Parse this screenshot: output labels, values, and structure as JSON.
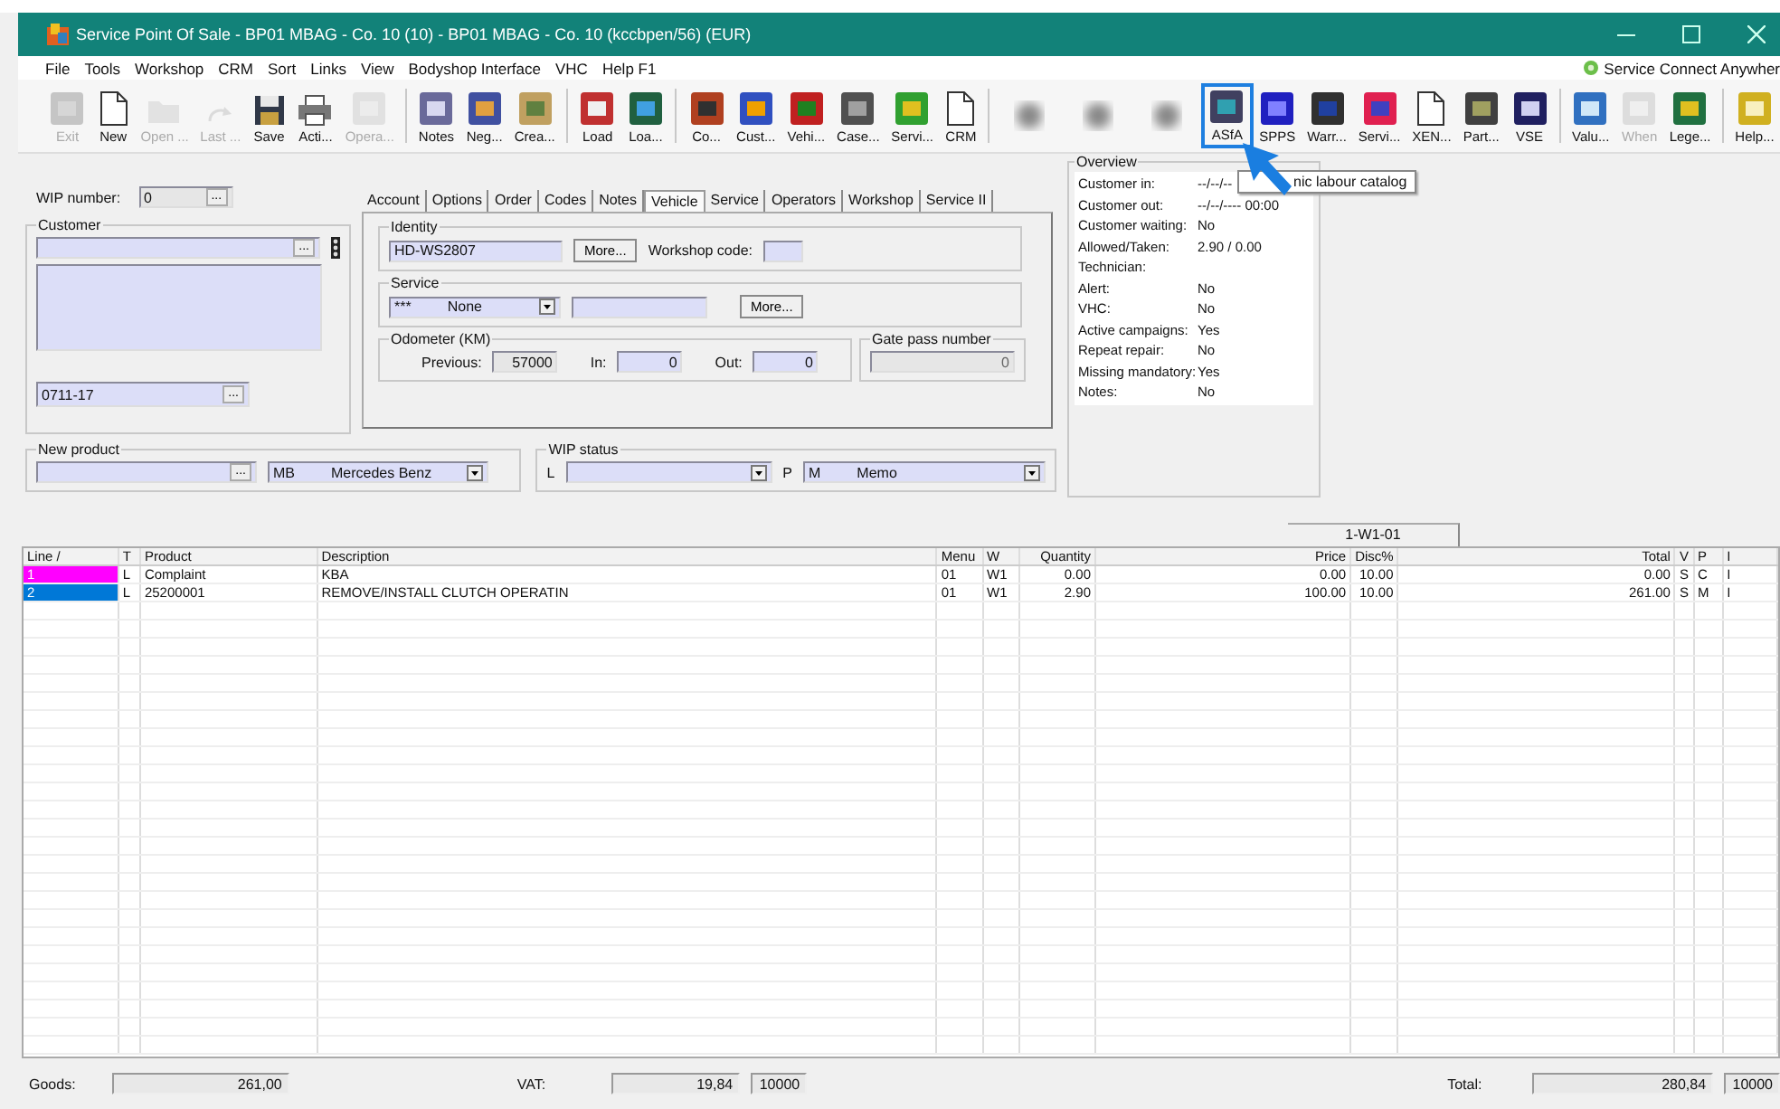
{
  "window": {
    "title": "Service Point Of Sale - BP01 MBAG - Co. 10 (10) - BP01 MBAG - Co. 10 (kccbpen/56) (EUR)"
  },
  "menu": [
    "File",
    "Tools",
    "Workshop",
    "CRM",
    "Sort",
    "Links",
    "View",
    "Bodyshop Interface",
    "VHC",
    "Help F1"
  ],
  "service_connect": "Service Connect Anywher",
  "toolbar": [
    [
      {
        "kind": "button",
        "label": "Exit",
        "disabled": true,
        "selected": false
      },
      {
        "kind": "button",
        "label": "New",
        "disabled": false,
        "selected": false
      },
      {
        "kind": "button",
        "label": "Open ... ",
        "disabled": true,
        "selected": false
      },
      {
        "kind": "button",
        "label": "Last ...",
        "disabled": true,
        "selected": false
      },
      {
        "kind": "button",
        "label": "Save",
        "disabled": false,
        "selected": false
      },
      {
        "kind": "button",
        "label": "Acti...",
        "disabled": false,
        "selected": false
      },
      {
        "kind": "button",
        "label": "Opera...",
        "disabled": true,
        "selected": false
      }
    ],
    [
      {
        "kind": "button",
        "label": "Notes",
        "disabled": false,
        "selected": false
      },
      {
        "kind": "button",
        "label": "Neg...",
        "disabled": false,
        "selected": false
      },
      {
        "kind": "button",
        "label": "Crea...",
        "disabled": false,
        "selected": false
      }
    ],
    [
      {
        "kind": "button",
        "label": "Load",
        "disabled": false,
        "selected": false
      },
      {
        "kind": "button",
        "label": "Loa...",
        "disabled": false,
        "selected": false
      }
    ],
    [
      {
        "kind": "button",
        "label": "Co...",
        "disabled": false,
        "selected": false
      },
      {
        "kind": "button",
        "label": "Cust...",
        "disabled": false,
        "selected": false
      },
      {
        "kind": "button",
        "label": "Vehi...",
        "disabled": false,
        "selected": false
      },
      {
        "kind": "button",
        "label": "Case...",
        "disabled": false,
        "selected": false
      },
      {
        "kind": "button",
        "label": "Servi...",
        "disabled": false,
        "selected": false
      },
      {
        "kind": "button",
        "label": "CRM",
        "disabled": false,
        "selected": false
      }
    ],
    [
      {
        "kind": "blurred"
      },
      {
        "kind": "blurred"
      },
      {
        "kind": "blurred"
      },
      {
        "kind": "button",
        "label": "ASfA",
        "disabled": false,
        "selected": true
      },
      {
        "kind": "button",
        "label": "SPPS",
        "disabled": false,
        "selected": false
      },
      {
        "kind": "button",
        "label": "Warr...",
        "disabled": false,
        "selected": false
      },
      {
        "kind": "button",
        "label": "Servi...",
        "disabled": false,
        "selected": false
      },
      {
        "kind": "button",
        "label": "XEN...",
        "disabled": false,
        "selected": false
      },
      {
        "kind": "button",
        "label": "Part...",
        "disabled": false,
        "selected": false
      },
      {
        "kind": "button",
        "label": "VSE",
        "disabled": false,
        "selected": false
      }
    ],
    [
      {
        "kind": "button",
        "label": "Valu...",
        "disabled": false,
        "selected": false
      },
      {
        "kind": "button",
        "label": "When",
        "disabled": true,
        "selected": false
      },
      {
        "kind": "button",
        "label": "Lege...",
        "disabled": false,
        "selected": false
      }
    ],
    [
      {
        "kind": "button",
        "label": "Help...",
        "disabled": false,
        "selected": false
      }
    ]
  ],
  "tooltip": "nic labour catalog",
  "wip": {
    "label": "WIP number:",
    "value": "0",
    "button": "..."
  },
  "customer": {
    "label": "Customer",
    "button": "...",
    "code": "0711-17",
    "code_button": "..."
  },
  "tabs": [
    {
      "label": "Account",
      "selected": false
    },
    {
      "label": "Options",
      "selected": false
    },
    {
      "label": "Order",
      "selected": false
    },
    {
      "label": "Codes",
      "selected": false
    },
    {
      "label": "Notes",
      "selected": false
    },
    {
      "label": "Vehicle",
      "selected": true
    },
    {
      "label": "Service",
      "selected": false
    },
    {
      "label": "Operators",
      "selected": false
    },
    {
      "label": "Workshop",
      "selected": false
    },
    {
      "label": "Service II",
      "selected": false
    }
  ],
  "identity": {
    "label": "Identity",
    "plate": "HD-WS2807",
    "more": "More...",
    "workshop_code_label": "Workshop code:"
  },
  "service": {
    "label": "Service",
    "code": "***",
    "value": "None",
    "more": "More..."
  },
  "odometer": {
    "label": "Odometer (KM)",
    "previous_label": "Previous:",
    "previous": "57000",
    "in_label": "In:",
    "in": "0",
    "out_label": "Out:",
    "out": "0"
  },
  "gate_pass": {
    "label": "Gate pass number",
    "value": "0"
  },
  "new_product": {
    "label": "New product",
    "button": "...",
    "make_code": "MB",
    "make": "Mercedes Benz"
  },
  "wip_status": {
    "label": "WIP status",
    "l_label": "L",
    "p_label": "P",
    "code": "M",
    "value": "Memo"
  },
  "overview": {
    "title": "Overview",
    "rows": [
      {
        "label": "Customer in:",
        "value": "--/--/--"
      },
      {
        "label": "Customer out:",
        "value": "--/--/---- 00:00"
      },
      {
        "label": "Customer waiting:",
        "value": "No"
      },
      {
        "label": "Allowed/Taken:",
        "value": "2.90 / 0.00"
      },
      {
        "label": "Technician:",
        "value": ""
      },
      {
        "label": "Alert:",
        "value": "No"
      },
      {
        "label": "VHC:",
        "value": "No"
      },
      {
        "label": "Active campaigns:",
        "value": "Yes"
      },
      {
        "label": "Repeat repair:",
        "value": "No"
      },
      {
        "label": "Missing mandatory:",
        "value": "Yes"
      },
      {
        "label": "Notes:",
        "value": "No"
      }
    ]
  },
  "job_tab": "1-W1-01",
  "table": {
    "columns": [
      "Line /",
      "T",
      "Product",
      "Description",
      "Menu",
      "W",
      "Quantity",
      "Price",
      "Disc%",
      "Total",
      "V",
      "P",
      "I"
    ],
    "rows": [
      {
        "color": "#ff00ff",
        "cells": [
          "1",
          "L",
          "Complaint",
          "KBA",
          "01",
          "W1",
          "0.00",
          "0.00",
          "10.00",
          "0.00",
          "S",
          "C",
          "I"
        ]
      },
      {
        "color": "#0078d7",
        "cells": [
          "2",
          "L",
          "25200001",
          "REMOVE/INSTALL CLUTCH OPERATIN",
          "01",
          "W1",
          "2.90",
          "100.00",
          "10.00",
          "261.00",
          "S",
          "M",
          "I"
        ]
      }
    ]
  },
  "totals": {
    "goods_label": "Goods:",
    "goods": "261,00",
    "vat_label": "VAT:",
    "vat": "19,84",
    "vat_code": "10000",
    "total_label": "Total:",
    "total": "280,84",
    "total_code": "10000"
  }
}
